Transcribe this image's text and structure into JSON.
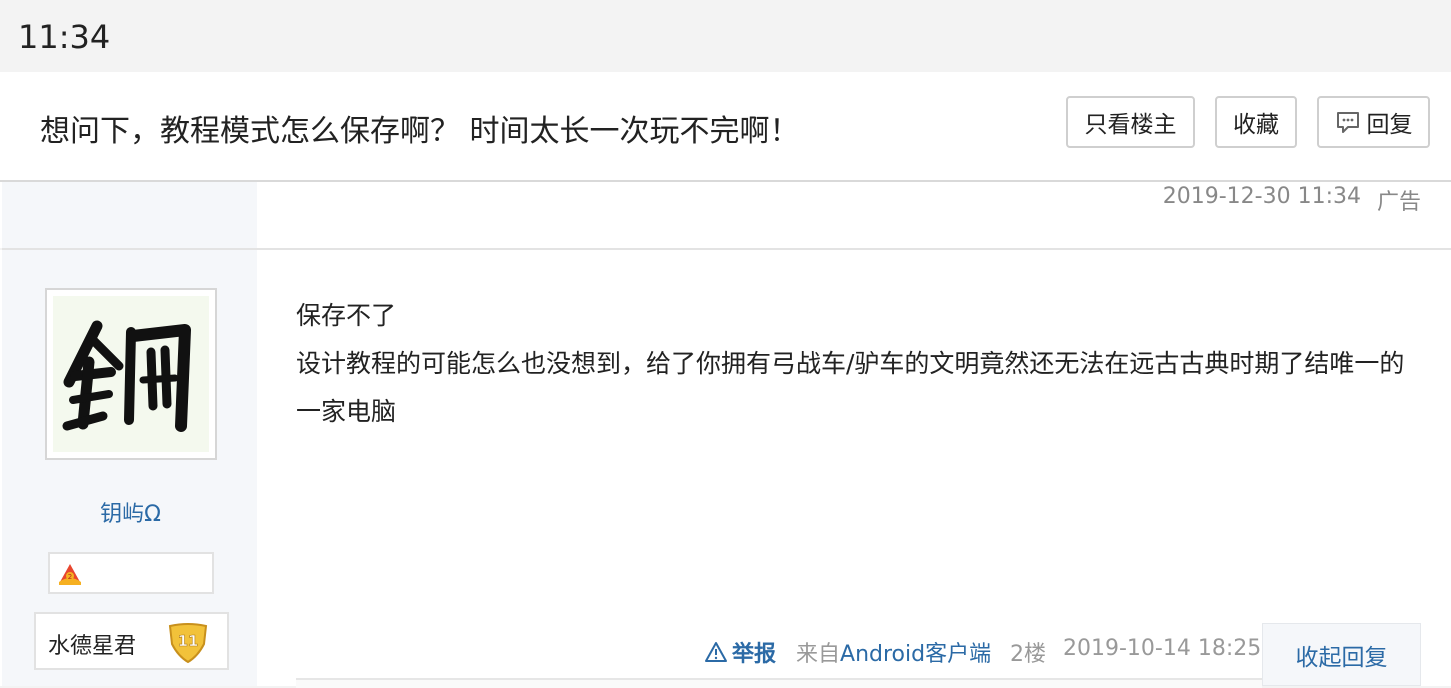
{
  "status_bar": {
    "time": "11:34"
  },
  "thread": {
    "title": "想问下，教程模式怎么保存啊？ 时间太长一次玩不完啊！",
    "buttons": {
      "only_owner": "只看楼主",
      "favorite": "收藏",
      "reply": "回复"
    }
  },
  "ad_row": {
    "date": "2019-12-30 11:34",
    "label": "广告"
  },
  "post": {
    "author": {
      "name": "钥屿Ω",
      "avatar_icon": "calligraphy-avatar",
      "medal_icon": "medal-icon",
      "level_title": "水德星君",
      "level_number": "11"
    },
    "content": [
      "保存不了",
      "设计教程的可能怎么也没想到，给了你拥有弓战车/驴车的文明竟然还无法在远古古典时期了结唯一的一家电脑"
    ],
    "meta": {
      "report": "举报",
      "from_prefix": "来自",
      "client": "Android客户端",
      "floor": "2楼",
      "date": "2019-10-14 18:25",
      "collapse_reply": "收起回复"
    }
  },
  "colors": {
    "link_blue": "#2b6aa6",
    "meta_gray": "#999999",
    "left_column": "#f5f7fa"
  }
}
